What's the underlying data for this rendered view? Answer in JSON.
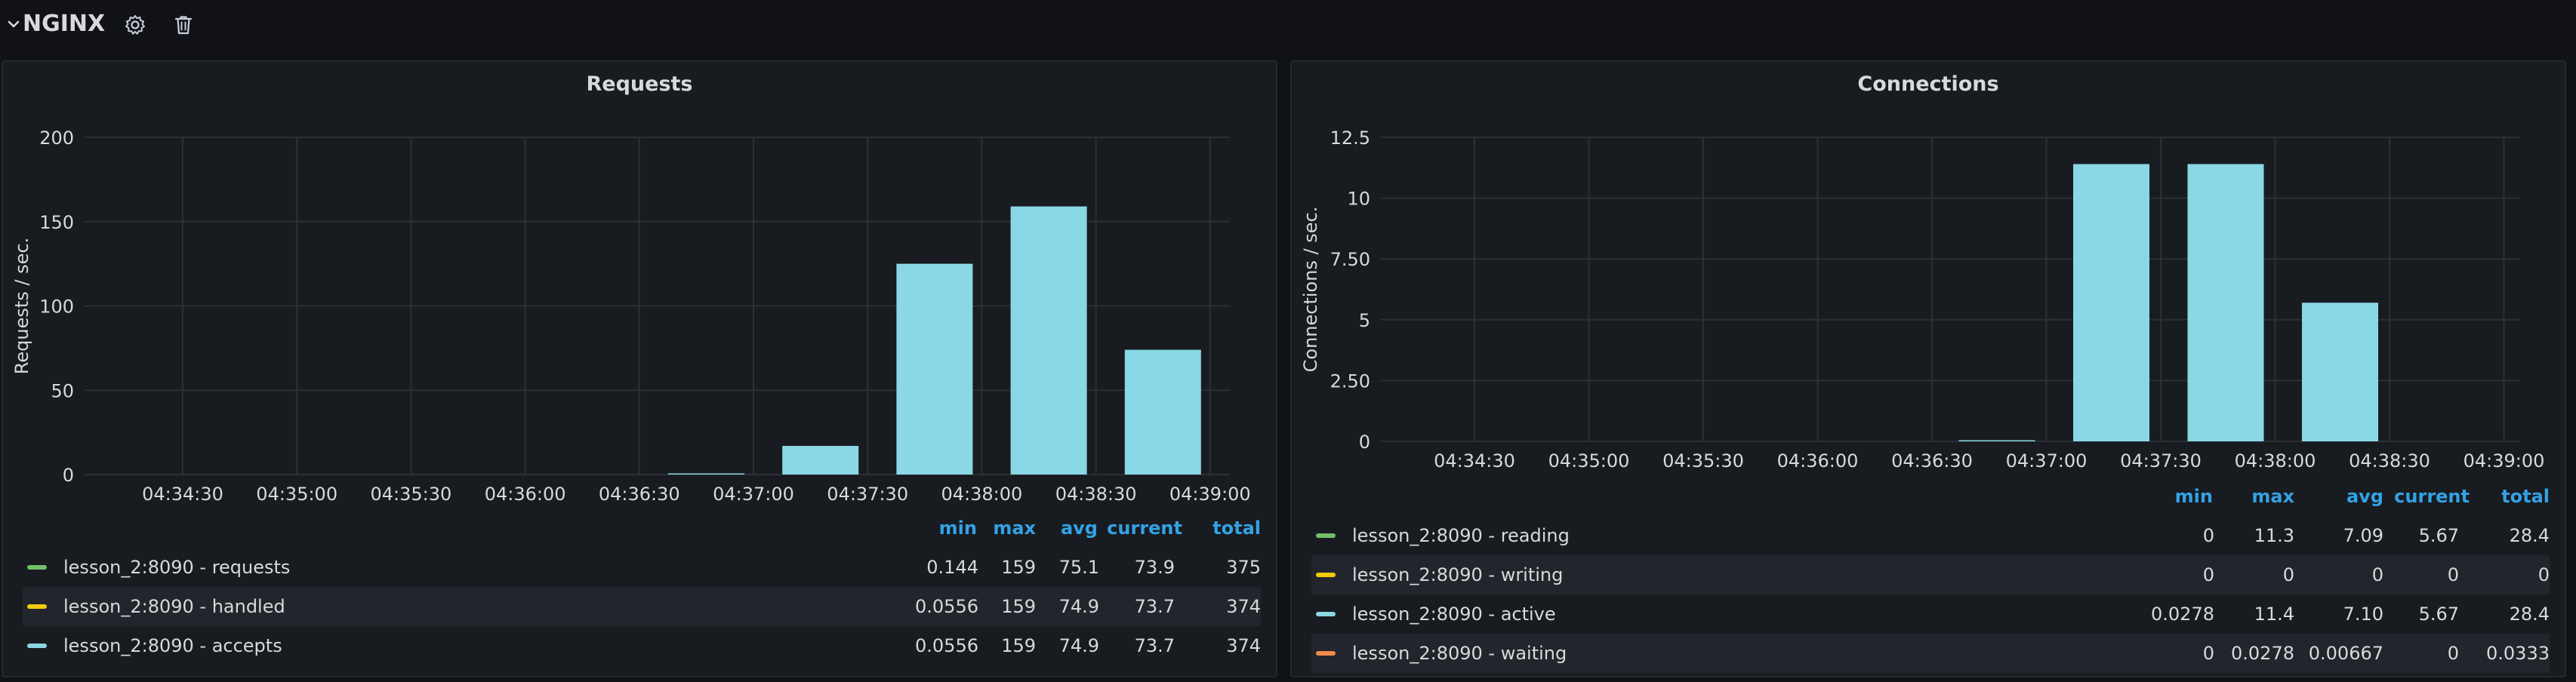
{
  "row": {
    "title": "NGINX"
  },
  "panels": [
    {
      "title": "Requests",
      "legend_headers": [
        "min",
        "max",
        "avg",
        "current",
        "total"
      ],
      "legend": [
        {
          "label": "lesson_2:8090 - requests",
          "color": "#73bf69",
          "values": [
            "0.144",
            "159",
            "75.1",
            "73.9",
            "375"
          ]
        },
        {
          "label": "lesson_2:8090 - handled",
          "color": "#f2cc0c",
          "values": [
            "0.0556",
            "159",
            "74.9",
            "73.7",
            "374"
          ]
        },
        {
          "label": "lesson_2:8090 - accepts",
          "color": "#8ad7e6",
          "values": [
            "0.0556",
            "159",
            "74.9",
            "73.7",
            "374"
          ]
        }
      ]
    },
    {
      "title": "Connections",
      "legend_headers": [
        "min",
        "max",
        "avg",
        "current",
        "total"
      ],
      "legend": [
        {
          "label": "lesson_2:8090 - reading",
          "color": "#73bf69",
          "values": [
            "0",
            "11.3",
            "7.09",
            "5.67",
            "28.4"
          ]
        },
        {
          "label": "lesson_2:8090 - writing",
          "color": "#f2cc0c",
          "values": [
            "0",
            "0",
            "0",
            "0",
            "0"
          ]
        },
        {
          "label": "lesson_2:8090 - active",
          "color": "#8ad7e6",
          "values": [
            "0.0278",
            "11.4",
            "7.10",
            "5.67",
            "28.4"
          ]
        },
        {
          "label": "lesson_2:8090 - waiting",
          "color": "#f08a4b",
          "values": [
            "0",
            "0.0278",
            "0.00667",
            "0",
            "0.0333"
          ]
        }
      ]
    }
  ],
  "chart_data": [
    {
      "type": "bar",
      "title": "Requests",
      "ylabel": "Requests / sec.",
      "ylim": [
        0,
        200
      ],
      "y_ticks": [
        "0",
        "50",
        "100",
        "150",
        "200"
      ],
      "x_ticks": [
        "04:34:30",
        "04:35:00",
        "04:35:30",
        "04:36:00",
        "04:36:30",
        "04:37:00",
        "04:37:30",
        "04:38:00",
        "04:38:30",
        "04:39:00"
      ],
      "grid": true,
      "bar_color": "#8ad7e6",
      "series": [
        {
          "name": "lesson_2:8090 - accepts",
          "values": [
            0,
            0,
            0,
            0,
            0,
            0.5,
            17,
            125,
            159,
            74
          ]
        }
      ]
    },
    {
      "type": "bar",
      "title": "Connections",
      "ylabel": "Connections / sec.",
      "ylim": [
        0,
        12.5
      ],
      "y_ticks": [
        "0",
        "2.50",
        "5",
        "7.50",
        "10",
        "12.5"
      ],
      "x_ticks": [
        "04:34:30",
        "04:35:00",
        "04:35:30",
        "04:36:00",
        "04:36:30",
        "04:37:00",
        "04:37:30",
        "04:38:00",
        "04:38:30",
        "04:39:00"
      ],
      "grid": true,
      "bar_color": "#8ad7e6",
      "series": [
        {
          "name": "lesson_2:8090 - active",
          "values": [
            0,
            0,
            0,
            0,
            0,
            0.03,
            11.4,
            11.4,
            5.7,
            0
          ]
        }
      ]
    }
  ]
}
